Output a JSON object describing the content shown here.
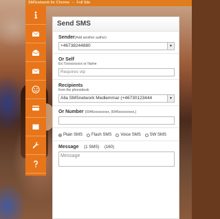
{
  "topbar": {
    "title": "SMSnetwork for Chrome",
    "separator": "–",
    "link": "Full Site"
  },
  "sidebar": {
    "items": [
      {
        "icon": "info-icon"
      },
      {
        "icon": "envelope-send-icon"
      },
      {
        "icon": "envelope-open-icon"
      },
      {
        "icon": "envelope-icon"
      },
      {
        "icon": "smiley-icon"
      },
      {
        "icon": "credit-card-icon"
      },
      {
        "icon": "book-icon"
      },
      {
        "icon": "wrench-icon"
      },
      {
        "icon": "question-icon"
      }
    ]
  },
  "form": {
    "heading": "Send SMS",
    "sender": {
      "label": "Sender",
      "hint": "(Add another author)",
      "value": "+46738244880"
    },
    "orself": {
      "label": "Or Self",
      "hint": "Ex:7xxxxxxxxxx or Name",
      "placeholder": "Requires vip"
    },
    "recipients": {
      "label": "Recipients",
      "hint": "from the phonebook",
      "value": "Alla SMSnetwork Medlemmar (+46730123444"
    },
    "ornumber": {
      "label": "Or Number",
      "hint": "(0046xxxxxxxxx, 0046xxxxxxxxx,)"
    },
    "smstypes": [
      {
        "label": "Plain SMS",
        "checked": true
      },
      {
        "label": "Flash SMS",
        "checked": false
      },
      {
        "label": "Voice SMS",
        "checked": false
      },
      {
        "label": "SW SMS",
        "checked": false
      }
    ],
    "message": {
      "label": "Message",
      "sms_count": "(1 SMS)",
      "char_count": "(160)",
      "placeholder": "Message"
    }
  }
}
